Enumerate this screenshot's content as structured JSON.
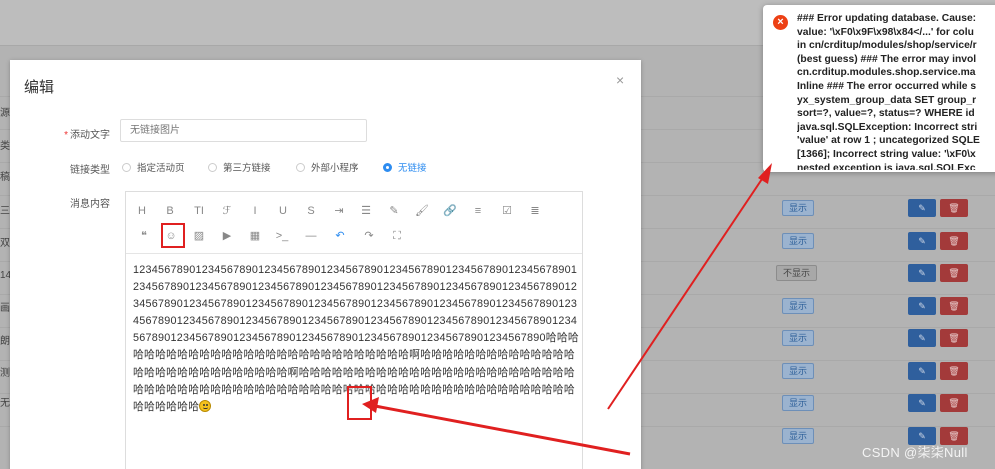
{
  "background": {
    "left_fragments": [
      "源",
      "类",
      "稿",
      "三",
      "双",
      "14",
      "画",
      "朗",
      "测",
      "无"
    ],
    "status_badges": [
      "显示",
      "显示",
      "不显示",
      "显示",
      "显示",
      "显示",
      "显示",
      "显示"
    ],
    "edit_icon": "pencil-icon",
    "delete_icon": "trash-icon"
  },
  "dialog": {
    "title": "编辑",
    "close": "×",
    "fields": {
      "text_label": "添动文字",
      "text_placeholder": "无链接图片",
      "link_type_label": "链接类型",
      "link_options": [
        "指定活动页",
        "第三方链接",
        "外部小程序",
        "无链接"
      ],
      "selected_link_option": "无链接",
      "content_label": "消息内容"
    }
  },
  "editor": {
    "toolbar": [
      {
        "icon": "heading-icon",
        "glyph": "H"
      },
      {
        "icon": "bold-icon",
        "glyph": "B"
      },
      {
        "icon": "font-size-icon",
        "glyph": "TI"
      },
      {
        "icon": "font-family-icon",
        "glyph": "ℱ"
      },
      {
        "icon": "italic-icon",
        "glyph": "I"
      },
      {
        "icon": "underline-icon",
        "glyph": "U"
      },
      {
        "icon": "strikethrough-icon",
        "glyph": "S"
      },
      {
        "icon": "indent-icon",
        "glyph": "⇥"
      },
      {
        "icon": "line-height-icon",
        "glyph": "☰"
      },
      {
        "icon": "font-color-icon",
        "glyph": "✎"
      },
      {
        "icon": "background-color-icon",
        "glyph": "🖌"
      },
      {
        "icon": "link-icon",
        "glyph": "🔗"
      },
      {
        "icon": "list-icon",
        "glyph": "≡"
      },
      {
        "icon": "todo-icon",
        "glyph": "☑"
      },
      {
        "icon": "justify-icon",
        "glyph": "≣"
      },
      {
        "icon": "quote-icon",
        "glyph": "❝"
      },
      {
        "icon": "emoji-icon",
        "glyph": "☺"
      },
      {
        "icon": "image-icon",
        "glyph": "▨"
      },
      {
        "icon": "video-icon",
        "glyph": "▶"
      },
      {
        "icon": "table-icon",
        "glyph": "▦"
      },
      {
        "icon": "code-icon",
        "glyph": ">_"
      },
      {
        "icon": "divider-icon",
        "glyph": "—"
      },
      {
        "icon": "undo-icon",
        "glyph": "↶"
      },
      {
        "icon": "redo-icon",
        "glyph": "↷"
      },
      {
        "icon": "fullscreen-icon",
        "glyph": "⛶"
      }
    ],
    "content": "12345678901234567890123456789012345678901234567890123456789012345678901234567890123456789012345678901234567890123456789012345678901234567890123456789012345678901234567890123456789012345678901234567890123456789012345678901234567890123456789012345678901234567890123456789012345678901234567890123456789012345678901234567890123456789012345678901234567890哈哈哈哈哈哈哈哈哈哈哈哈哈哈哈哈哈哈哈哈哈哈哈哈哈哈哈哈啊哈哈哈哈哈哈哈哈哈哈哈哈哈哈哈哈哈哈哈哈哈哈哈哈哈哈哈哈啊哈哈哈哈哈哈哈哈哈哈哈哈哈哈哈哈哈哈哈哈哈哈哈哈哈哈哈哈哈哈哈哈哈哈哈哈哈哈哈哈哈哈哈哈哈哈哈哈哈哈哈哈哈哈哈哈哈哈哈哈哈哈哈哈哈哈哈哈哈哈哈",
    "emoji": "grinning-face-emoji"
  },
  "toast": {
    "lines": "### Error updating database. Cause:\nvalue: '\\xF0\\x9F\\x98\\x84</...' for colu\nin cn/crditup/modules/shop/service/r\n(best guess) ### The error may invol\ncn.crditup.modules.shop.service.ma\nInline ### The error occurred while s\nyx_system_group_data SET group_r\nsort=?, value=?, status=? WHERE id\njava.sql.SQLException: Incorrect stri\n'value' at row 1 ; uncategorized SQLE\n[1366]; Incorrect string value: '\\xF0\\x\nnested exception is java.sql.SQLExc\n'\\xF0\\x9F\\x98\\x84</...' for column 'val",
    "icon": "error-icon"
  },
  "watermark": "CSDN @柒柒Null",
  "colors": {
    "accent": "#2d8cf0",
    "error": "#ed4014",
    "annotation": "#e02020"
  }
}
